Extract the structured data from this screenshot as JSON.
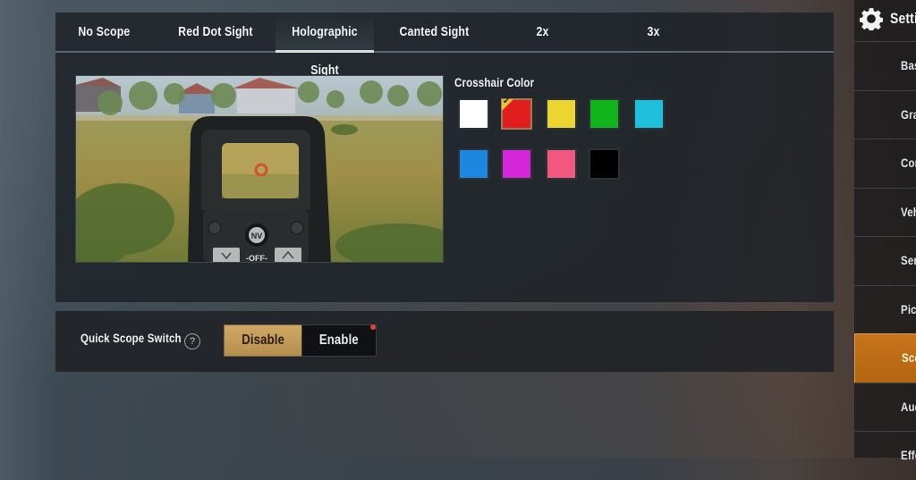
{
  "tabs": [
    {
      "label": "No Scope",
      "active": false
    },
    {
      "label": "Red Dot Sight",
      "active": false
    },
    {
      "label": "Holographic Sight",
      "active": true
    },
    {
      "label": "Canted Sight",
      "active": false
    },
    {
      "label": "2x",
      "active": false
    },
    {
      "label": "3x",
      "active": false
    }
  ],
  "preview": {
    "nv_label": "NV",
    "off_label": "-OFF-"
  },
  "crosshair": {
    "title": "Crosshair Color",
    "selected_index": 1,
    "colors": [
      {
        "name": "white",
        "hex": "#ffffff"
      },
      {
        "name": "red",
        "hex": "#e21d1d"
      },
      {
        "name": "yellow",
        "hex": "#ecd530"
      },
      {
        "name": "green",
        "hex": "#0fb51b"
      },
      {
        "name": "cyan",
        "hex": "#1ec0dc"
      },
      {
        "name": "blue",
        "hex": "#1d87e0"
      },
      {
        "name": "magenta",
        "hex": "#d226d8"
      },
      {
        "name": "pink",
        "hex": "#f2577f"
      },
      {
        "name": "black",
        "hex": "#000000"
      }
    ]
  },
  "quick_scope": {
    "label": "Quick Scope Switch",
    "help": "?",
    "options": [
      "Disable",
      "Enable"
    ],
    "selected": "Disable"
  },
  "sidebar": {
    "title": "Settings",
    "items": [
      {
        "label": "Basic",
        "active": false
      },
      {
        "label": "Graphics",
        "active": false
      },
      {
        "label": "Controls",
        "active": false
      },
      {
        "label": "Vehicle",
        "active": false
      },
      {
        "label": "Sensitivity",
        "active": false
      },
      {
        "label": "Pickup",
        "active": false
      },
      {
        "label": "Scope",
        "active": true
      },
      {
        "label": "Audio",
        "active": false
      },
      {
        "label": "Effects",
        "active": false
      }
    ]
  },
  "colors": {
    "accent_orange": "#c7741c",
    "disable_gold": "#c9a15e",
    "notification_dot": "#e2413a"
  }
}
